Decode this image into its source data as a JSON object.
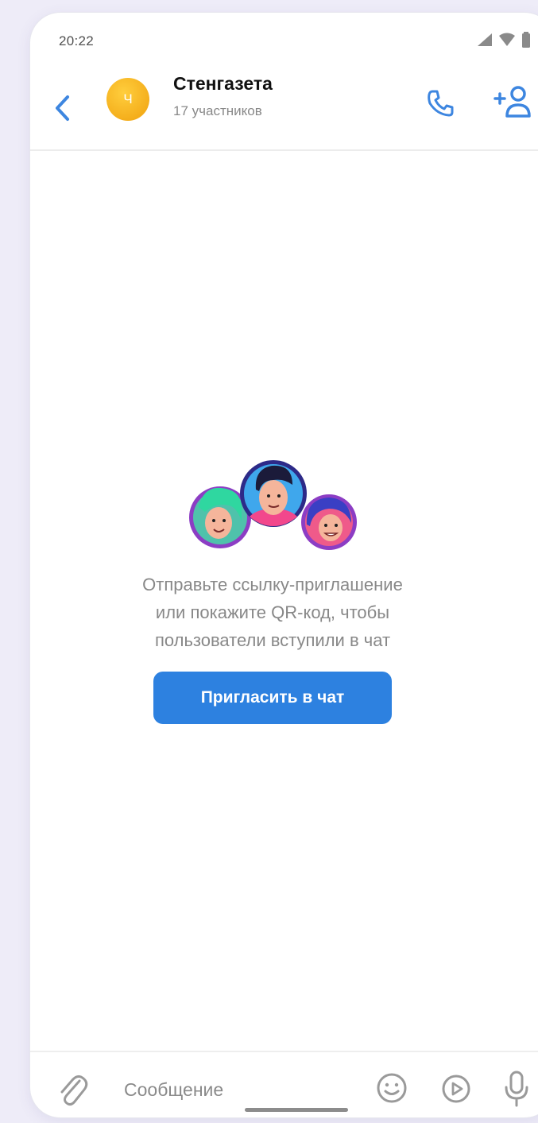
{
  "status_bar": {
    "time": "20:22"
  },
  "header": {
    "avatar_letter": "Ч",
    "title": "Стенгазета",
    "subtitle": "17 участников"
  },
  "empty_state": {
    "text": "Отправьте ссылку-приглашение\nили покажите QR-код, чтобы\nпользователи вступили в чат",
    "button_label": "Пригласить в чат"
  },
  "composer": {
    "placeholder": "Сообщение"
  },
  "icons": {
    "back": "chevron-left-icon",
    "call": "phone-icon",
    "add_member": "add-user-icon",
    "attach": "paperclip-icon",
    "emoji": "smile-icon",
    "video_message": "play-circle-icon",
    "voice": "microphone-icon"
  },
  "colors": {
    "accent": "#2d81e0",
    "avatar": "#f5b51b",
    "background": "#eeecf8"
  }
}
